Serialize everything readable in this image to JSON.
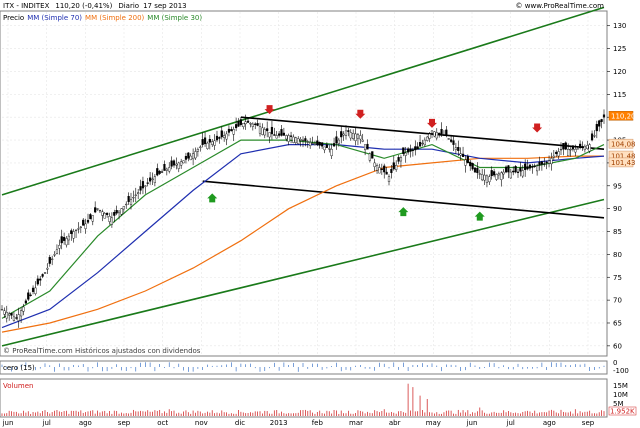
{
  "header": {
    "instrument": "ITX - INDITEX",
    "last_price": "110,20 (-0,41%)",
    "timeframe": "Diario",
    "date": "17 sep 2013",
    "watermark": "© www.ProRealTime.com"
  },
  "legend": {
    "price": "Precio",
    "mm70": "MM (Simple 70)",
    "mm200": "MM (Simple 200)",
    "mm30": "MM (Simple 30)"
  },
  "footer_note": "© ProRealTime.com Históricos ajustados con dividendos",
  "osc_panel": {
    "label": "cero (15)"
  },
  "vol_panel": {
    "label": "Volumen"
  },
  "colors": {
    "candle": "#000000",
    "mm70": "#1f2fb0",
    "mm200": "#f07010",
    "mm30": "#2a8a2a",
    "channel_green": "#1a7a1a",
    "channel_black": "#000000",
    "arrow_down": "#d02020",
    "arrow_up": "#1f9a1f",
    "volume": "#d03030",
    "price_badge": "#ff8000",
    "mm_badge": "#ffe0c0"
  },
  "chart_data": {
    "type": "candlestick",
    "x_ticks": [
      "jun",
      "jul",
      "ago",
      "sep",
      "oct",
      "nov",
      "dic",
      "2013",
      "feb",
      "mar",
      "abr",
      "may",
      "jun",
      "jul",
      "ago",
      "sep"
    ],
    "y_ticks": [
      60,
      65,
      70,
      75,
      80,
      85,
      90,
      95,
      100,
      105,
      110,
      115,
      120,
      125,
      130
    ],
    "ylim": [
      58,
      133
    ],
    "badges": [
      {
        "label": "110,20",
        "value": 110.2,
        "kind": "price"
      },
      {
        "label": "104,08",
        "value": 104.1,
        "kind": "mm"
      },
      {
        "label": "101,48",
        "value": 101.5,
        "kind": "mm"
      },
      {
        "label": "101,43",
        "value": 100.0,
        "kind": "mm"
      }
    ],
    "osc_ticks": [
      "0",
      "-100"
    ],
    "vol_ticks": [
      "15M",
      "10M",
      "5M",
      "1.952K"
    ],
    "close_path": [
      [
        0,
        68
      ],
      [
        6,
        66
      ],
      [
        12,
        71
      ],
      [
        18,
        76
      ],
      [
        24,
        82
      ],
      [
        30,
        85
      ],
      [
        36,
        87
      ],
      [
        40,
        90
      ],
      [
        46,
        88
      ],
      [
        52,
        91
      ],
      [
        58,
        94
      ],
      [
        64,
        97
      ],
      [
        70,
        99
      ],
      [
        78,
        101
      ],
      [
        84,
        104
      ],
      [
        90,
        105
      ],
      [
        96,
        107
      ],
      [
        102,
        109
      ],
      [
        108,
        108
      ],
      [
        114,
        106
      ],
      [
        120,
        106
      ],
      [
        126,
        105
      ],
      [
        132,
        104
      ],
      [
        138,
        103
      ],
      [
        144,
        107
      ],
      [
        150,
        106
      ],
      [
        156,
        100
      ],
      [
        162,
        97
      ],
      [
        168,
        102
      ],
      [
        174,
        103
      ],
      [
        180,
        107
      ],
      [
        186,
        106
      ],
      [
        192,
        102
      ],
      [
        198,
        98
      ],
      [
        204,
        97
      ],
      [
        210,
        98
      ],
      [
        216,
        98
      ],
      [
        222,
        99
      ],
      [
        228,
        100
      ],
      [
        234,
        103
      ],
      [
        240,
        103
      ],
      [
        246,
        104
      ],
      [
        252,
        110
      ]
    ],
    "mm30_path": [
      [
        0,
        66
      ],
      [
        20,
        72
      ],
      [
        40,
        84
      ],
      [
        60,
        93
      ],
      [
        80,
        99
      ],
      [
        100,
        105
      ],
      [
        120,
        105
      ],
      [
        140,
        104
      ],
      [
        160,
        101
      ],
      [
        180,
        104
      ],
      [
        200,
        99
      ],
      [
        220,
        99
      ],
      [
        240,
        101
      ],
      [
        252,
        104
      ]
    ],
    "mm70_path": [
      [
        0,
        64
      ],
      [
        20,
        68
      ],
      [
        40,
        76
      ],
      [
        60,
        85
      ],
      [
        80,
        94
      ],
      [
        100,
        102
      ],
      [
        120,
        104
      ],
      [
        140,
        104
      ],
      [
        160,
        103
      ],
      [
        180,
        103
      ],
      [
        200,
        101
      ],
      [
        220,
        100
      ],
      [
        240,
        101
      ],
      [
        252,
        101.5
      ]
    ],
    "mm200_path": [
      [
        0,
        63
      ],
      [
        20,
        65
      ],
      [
        40,
        68
      ],
      [
        60,
        72
      ],
      [
        80,
        77
      ],
      [
        100,
        83
      ],
      [
        120,
        90
      ],
      [
        140,
        95
      ],
      [
        160,
        99
      ],
      [
        180,
        100
      ],
      [
        200,
        101
      ],
      [
        220,
        101
      ],
      [
        240,
        101.5
      ],
      [
        252,
        101.5
      ]
    ],
    "channel_green_upper": [
      [
        0,
        93
      ],
      [
        252,
        134
      ]
    ],
    "channel_green_lower": [
      [
        0,
        60
      ],
      [
        252,
        92
      ]
    ],
    "channel_black_upper": [
      [
        100,
        110
      ],
      [
        252,
        103
      ]
    ],
    "channel_black_lower": [
      [
        84,
        96
      ],
      [
        252,
        88
      ]
    ],
    "down_arrows": [
      [
        112,
        110
      ],
      [
        150,
        109
      ],
      [
        180,
        107
      ],
      [
        224,
        106
      ]
    ],
    "up_arrows": [
      [
        88,
        94
      ],
      [
        168,
        91
      ],
      [
        200,
        90
      ]
    ],
    "volume_bars": [
      [
        10,
        0.1
      ],
      [
        30,
        0.15
      ],
      [
        50,
        0.1
      ],
      [
        70,
        0.2
      ],
      [
        90,
        0.1
      ],
      [
        110,
        0.15
      ],
      [
        130,
        0.1
      ],
      [
        150,
        0.15
      ],
      [
        160,
        0.2
      ],
      [
        170,
        0.95
      ],
      [
        172,
        0.85
      ],
      [
        175,
        0.6
      ],
      [
        178,
        0.5
      ],
      [
        200,
        0.25
      ],
      [
        220,
        0.15
      ],
      [
        240,
        0.2
      ]
    ]
  }
}
